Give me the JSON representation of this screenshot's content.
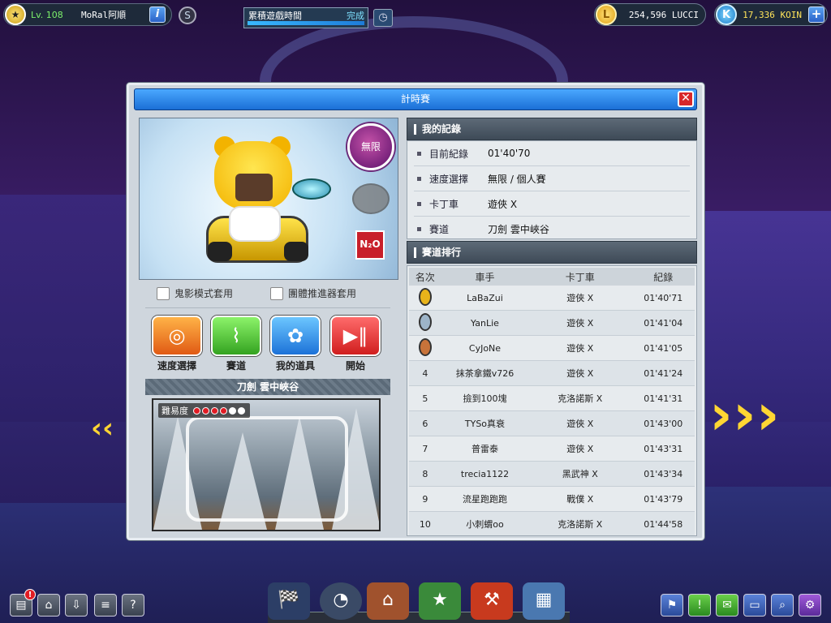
{
  "player": {
    "level": "Lv. 108",
    "nickname": "MoRal阿順"
  },
  "quest": {
    "name": "累積遊戲時間",
    "status": "完成",
    "progress": 1.0
  },
  "currency": {
    "lucci_value": "254,596 LUCCI",
    "lucci_icon_glyph": "L",
    "koin_value": "17,336 KOIN",
    "koin_icon_glyph": "K"
  },
  "dialog": {
    "title": "計時賽"
  },
  "kart_view": {
    "mode_badge": "無限",
    "n2o_label": "N₂O"
  },
  "options": {
    "ghost_mode": "鬼影模式套用",
    "team_booster": "團體推進器套用"
  },
  "actions": [
    {
      "label": "速度選擇"
    },
    {
      "label": "賽道"
    },
    {
      "label": "我的道具"
    },
    {
      "label": "開始"
    }
  ],
  "track": {
    "name": "刀劍 雲中峽谷",
    "difficulty_label": "難易度",
    "difficulty_filled": 4,
    "difficulty_total": 6
  },
  "my_record": {
    "header": "我的記錄",
    "rows": [
      {
        "key": "目前紀錄",
        "value": "01'40'70"
      },
      {
        "key": "速度選擇",
        "value": "無限 / 個人賽"
      },
      {
        "key": "卡丁車",
        "value": "遊俠 X"
      },
      {
        "key": "賽道",
        "value": "刀劍 雲中峽谷"
      }
    ]
  },
  "ranking": {
    "header": "賽道排行",
    "columns": [
      "名次",
      "車手",
      "卡丁車",
      "紀錄"
    ],
    "rows": [
      {
        "rank": "",
        "medal": "gold",
        "driver": "LaBaZui",
        "kart": "遊俠 X",
        "time": "01'40'71"
      },
      {
        "rank": "",
        "medal": "silver",
        "driver": "YanLie",
        "kart": "遊俠 X",
        "time": "01'41'04"
      },
      {
        "rank": "",
        "medal": "bronze",
        "driver": "CyJoNe",
        "kart": "遊俠 X",
        "time": "01'41'05"
      },
      {
        "rank": "4",
        "driver": "抹茶拿鐵v726",
        "kart": "遊俠 X",
        "time": "01'41'24"
      },
      {
        "rank": "5",
        "driver": "撿到100塊",
        "kart": "克洛諾斯 X",
        "time": "01'41'31"
      },
      {
        "rank": "6",
        "driver": "TYSo真衰",
        "kart": "遊俠 X",
        "time": "01'43'00"
      },
      {
        "rank": "7",
        "driver": "普雷泰",
        "kart": "遊俠 X",
        "time": "01'43'31"
      },
      {
        "rank": "8",
        "driver": "trecia1122",
        "kart": "黑武神 X",
        "time": "01'43'34"
      },
      {
        "rank": "9",
        "driver": "流星跑跑跑",
        "kart": "戰僕 X",
        "time": "01'43'79"
      },
      {
        "rank": "10",
        "driver": "小刺蝟oo",
        "kart": "克洛諾斯 X",
        "time": "01'44'58"
      }
    ]
  },
  "notifications": {
    "badge": "!"
  },
  "colors": {
    "title_blue": "#1b6fd6",
    "gold": "#e8b31a",
    "silver": "#9db4c8",
    "bronze": "#c8733a"
  }
}
